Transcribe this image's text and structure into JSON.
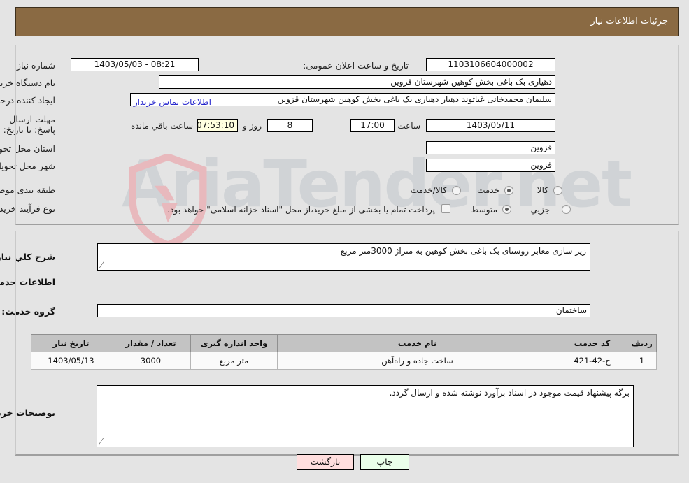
{
  "header": {
    "title": "جزئیات اطلاعات نیاز",
    "bar_color": "#8a6a43"
  },
  "watermark": {
    "text": "AriaTender.net"
  },
  "top_form": {
    "need_number": {
      "label": "شماره نیاز:",
      "value": "1103106604000002"
    },
    "announce_datetime": {
      "label": "تاریخ و ساعت اعلان عمومی:",
      "value": "08:21 - 1403/05/03"
    },
    "buyer_org": {
      "label": "نام دستگاه خریدار:",
      "value": "دهیاری بک باغی بخش کوهین شهرستان قزوین"
    },
    "request_creator": {
      "label": "ایجاد کننده درخواست:",
      "value": "سلیمان محمدخانی غیاثوند دهیار دهیاری بک باغی بخش کوهین شهرستان قزوین"
    },
    "contact_link": "اطلاعات تماس خریدار",
    "deadline": {
      "label": "مهلت ارسال پاسخ: تا تاریخ:",
      "date": "1403/05/11",
      "hour_label": "ساعت",
      "hour": "17:00",
      "days": "8",
      "days_unit": "روز و",
      "remaining": "07:53:10",
      "remaining_unit": "ساعت باقي مانده"
    },
    "delivery_province": {
      "label": "استان محل تحویل:",
      "value": "قزوین"
    },
    "delivery_city": {
      "label": "شهر محل تحویل:",
      "value": "قزوین"
    },
    "category": {
      "label": "طبقه بندی موضوعی:",
      "options": [
        {
          "label": "کالا",
          "selected": false
        },
        {
          "label": "خدمت",
          "selected": true
        },
        {
          "label": "کالا/خدمت",
          "selected": false
        }
      ]
    },
    "purchase_type": {
      "label": "نوع فرآیند خرید :",
      "options": [
        {
          "label": "جزیي",
          "selected": false
        },
        {
          "label": "متوسط",
          "selected": true
        }
      ]
    },
    "treasury_note": {
      "checked": false,
      "text": "پرداخت تمام یا بخشی از مبلغ خرید،از محل \"اسناد خزانه اسلامی\" خواهد بود."
    }
  },
  "main": {
    "need_summary": {
      "label": "شرح كلي نیاز:",
      "value": "زیر سازی معابر روستای بک باغی بخش کوهین به متراژ 3000متر مربع"
    },
    "services_heading": "اطلاعات خدمات مورد نیاز",
    "service_group": {
      "label": "گروه خدمت:",
      "value": "ساختمان"
    },
    "table": {
      "columns": [
        "ردیف",
        "کد خدمت",
        "نام خدمت",
        "واحد اندازه گیری",
        "تعداد / مقدار",
        "تاریخ نیاز"
      ],
      "rows": [
        {
          "index": "1",
          "code": "ج-42-421",
          "name": "ساخت جاده و راه‌آهن",
          "unit": "متر مربع",
          "quantity": "3000",
          "need_date": "1403/05/13"
        }
      ]
    },
    "buyer_notes": {
      "label": "توضیحات خریدار:",
      "value": "برگه پیشنهاد قیمت موجود در اسناد برآورد نوشته شده و ارسال گردد."
    }
  },
  "buttons": {
    "print": {
      "label": "چاپ",
      "color": "#eaffea"
    },
    "back": {
      "label": "بازگشت",
      "color": "#ffdede"
    }
  }
}
